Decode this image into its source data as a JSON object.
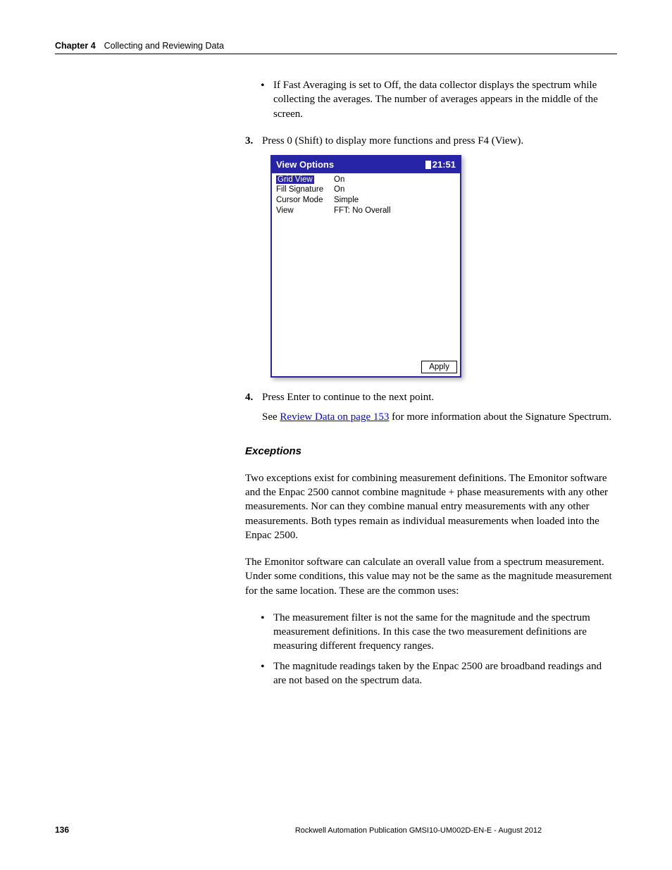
{
  "header": {
    "chapter_label": "Chapter 4",
    "chapter_title": "Collecting and Reviewing Data"
  },
  "bullets_top": [
    "If Fast Averaging is set to Off, the data collector displays the spectrum while collecting the averages. The number of averages appears in the middle of the screen."
  ],
  "step3": {
    "num": "3.",
    "text": "Press 0 (Shift) to display more functions and press F4 (View)."
  },
  "device": {
    "title": "View Options",
    "time": "21:51",
    "rows": [
      {
        "label": "Grid View",
        "value": "On"
      },
      {
        "label": "Fill Signature",
        "value": "On"
      },
      {
        "label": "Cursor Mode",
        "value": "Simple"
      },
      {
        "label": "View",
        "value": "FFT: No Overall"
      }
    ],
    "apply": "Apply"
  },
  "step4": {
    "num": "4.",
    "text": "Press Enter to continue to the next point.",
    "sub_pre": "See ",
    "sub_link": "Review Data on page 153",
    "sub_post": " for more information about the Signature Spectrum."
  },
  "exceptions": {
    "heading": "Exceptions",
    "p1": "Two exceptions exist for combining measurement definitions. The Emonitor software and the Enpac 2500 cannot combine magnitude + phase measurements with any other measurements. Nor can they combine manual entry measurements with any other measurements. Both types remain as individual measurements when loaded into the Enpac 2500.",
    "p2": "The Emonitor software can calculate an overall value from a spectrum measurement. Under some conditions, this value may not be the same as the magnitude measurement for the same location. These are the common uses:",
    "bullets": [
      "The measurement filter is not the same for the magnitude and the spectrum measurement definitions. In this case the two measurement definitions are measuring different frequency ranges.",
      "The magnitude readings taken by the Enpac 2500 are broadband readings and are not based on the spectrum data."
    ]
  },
  "footer": {
    "page": "136",
    "pub": "Rockwell Automation Publication GMSI10-UM002D-EN-E - August 2012"
  }
}
